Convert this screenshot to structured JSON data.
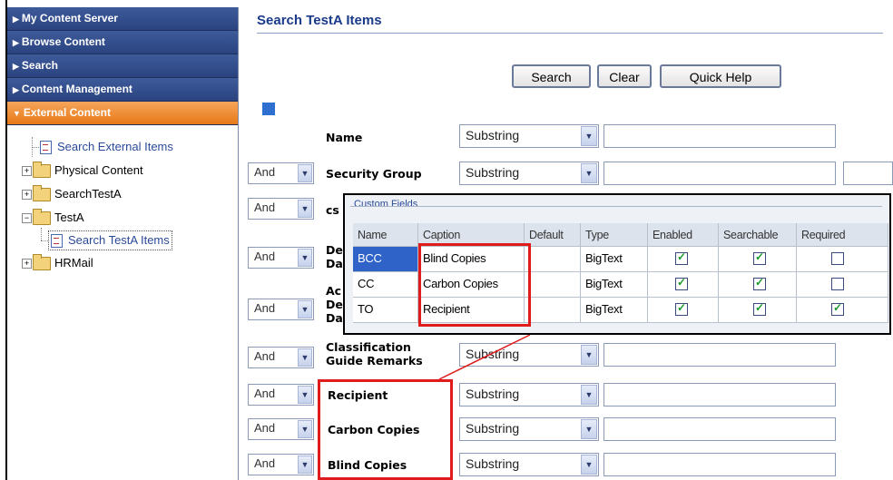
{
  "nav": {
    "headers": [
      {
        "label": "My Content Server",
        "active": false
      },
      {
        "label": "Browse Content",
        "active": false
      },
      {
        "label": "Search",
        "active": false
      },
      {
        "label": "Content Management",
        "active": false
      },
      {
        "label": "External Content",
        "active": true
      }
    ],
    "tree": [
      {
        "label": "Search External Items",
        "kind": "doc"
      },
      {
        "label": "Physical Content",
        "kind": "folder"
      },
      {
        "label": "SearchTestA",
        "kind": "folder"
      },
      {
        "label": "TestA",
        "kind": "folder"
      },
      {
        "label": "Search TestA Items",
        "kind": "doc"
      },
      {
        "label": "HRMail",
        "kind": "folder"
      }
    ]
  },
  "main": {
    "title": "Search TestA Items",
    "buttons": {
      "search": "Search",
      "clear": "Clear",
      "help": "Quick Help"
    },
    "conjunction": "And",
    "rows": [
      {
        "label": "Name",
        "op": "Substring"
      },
      {
        "label": "Security Group",
        "op": "Substring"
      },
      {
        "label": "cs",
        "op": ""
      },
      {
        "label1": "De",
        "label2": "Da"
      },
      {
        "label1": "Ac",
        "label2": "De",
        "label3": "Da"
      },
      {
        "label1": "Classification",
        "label2": "Guide Remarks",
        "op": "Substring"
      },
      {
        "label": "Recipient",
        "op": "Substring"
      },
      {
        "label": "Carbon Copies",
        "op": "Substring"
      },
      {
        "label": "Blind Copies",
        "op": "Substring"
      }
    ]
  },
  "custom_fields": {
    "legend": "Custom Fields",
    "columns": [
      "Name",
      "Caption",
      "Default",
      "Type",
      "Enabled",
      "Searchable",
      "Required"
    ],
    "rows": [
      {
        "name": "BCC",
        "caption": "Blind Copies",
        "default": "",
        "type": "BigText",
        "enabled": true,
        "searchable": true,
        "required": false
      },
      {
        "name": "CC",
        "caption": "Carbon Copies",
        "default": "",
        "type": "BigText",
        "enabled": true,
        "searchable": true,
        "required": false
      },
      {
        "name": "TO",
        "caption": "Recipient",
        "default": "",
        "type": "BigText",
        "enabled": true,
        "searchable": true,
        "required": true
      }
    ]
  },
  "colors": {
    "nav_header": "#2b4480",
    "nav_active": "#e77918",
    "title": "#1a3a8a",
    "highlight": "#e01b1b",
    "selected_row": "#2f63c8"
  }
}
